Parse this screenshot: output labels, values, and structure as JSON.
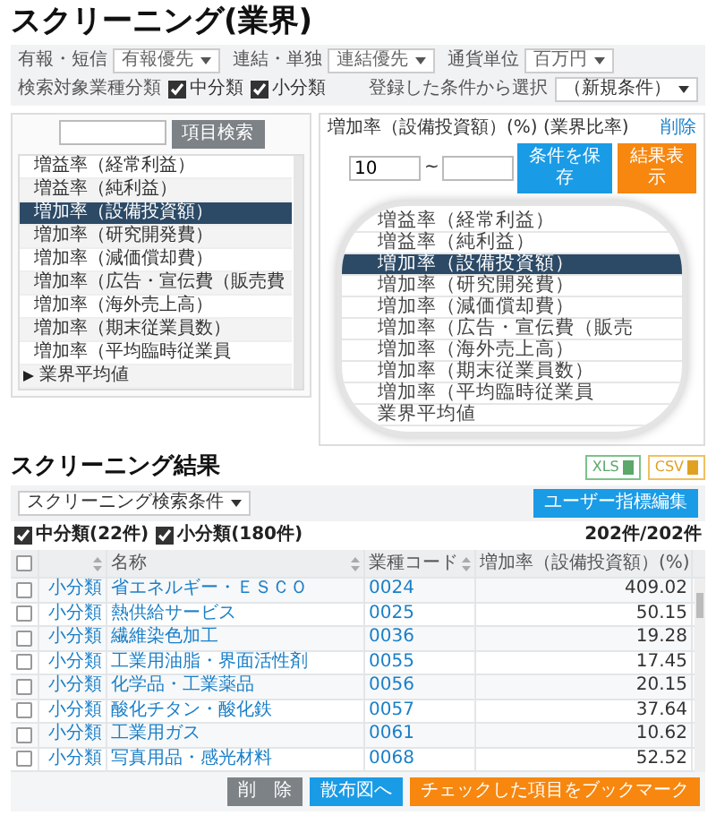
{
  "title": "スクリーニング(業界)",
  "options": [
    {
      "label": "有報・短信",
      "value": "有報優先"
    },
    {
      "label": "連結・単独",
      "value": "連結優先"
    },
    {
      "label": "通貨単位",
      "value": "百万円"
    }
  ],
  "target_filter": {
    "label": "検索対象業種分類",
    "options": [
      {
        "label": "中分類",
        "checked": true
      },
      {
        "label": "小分類",
        "checked": true
      }
    ]
  },
  "saved_conditions": {
    "label": "登録した条件から選択",
    "value": "（新規条件）"
  },
  "item_search": {
    "button": "項目検索"
  },
  "item_list": [
    {
      "kind": "item",
      "label": "増益率（経常利益）",
      "selected": false
    },
    {
      "kind": "item",
      "label": "増益率（純利益）",
      "selected": false
    },
    {
      "kind": "item",
      "label": "増加率（設備投資額）",
      "selected": true
    },
    {
      "kind": "item",
      "label": "増加率（研究開発費）",
      "selected": false
    },
    {
      "kind": "item",
      "label": "増加率（減価償却費）",
      "selected": false
    },
    {
      "kind": "item",
      "label": "増加率（広告・宣伝費（販売費",
      "selected": false
    },
    {
      "kind": "item",
      "label": "増加率（海外売上高）",
      "selected": false
    },
    {
      "kind": "item",
      "label": "増加率（期末従業員数）",
      "selected": false
    },
    {
      "kind": "item",
      "label": "増加率（平均臨時従業員",
      "selected": false
    },
    {
      "kind": "group",
      "label": "業界平均値",
      "selected": false,
      "expanded": false
    }
  ],
  "condition": {
    "label": "増加率（設備投資額）(%) (業界比率)",
    "delete": "削除",
    "min": "10",
    "separator": "~"
  },
  "magnifier": {
    "items": [
      {
        "label": "増益率（経常利益）",
        "selected": false
      },
      {
        "label": "増益率（純利益）",
        "selected": false
      },
      {
        "label": "増加率（設備投資額）",
        "selected": true
      },
      {
        "label": "増加率（研究開発費）",
        "selected": false
      },
      {
        "label": "増加率（減価償却費）",
        "selected": false
      },
      {
        "label": "増加率（広告・宣伝費（販売",
        "selected": false
      },
      {
        "label": "増加率（海外売上高）",
        "selected": false
      },
      {
        "label": "増加率（期末従業員数）",
        "selected": false
      },
      {
        "label": "増加率（平均臨時従業員",
        "selected": false
      },
      {
        "label": "業界平均値",
        "selected": false
      }
    ]
  },
  "condition_buttons": [
    {
      "label": "条件を保存",
      "kind": "primary"
    },
    {
      "label": "結果表示",
      "kind": "accent"
    }
  ],
  "results": {
    "title": "スクリーニング結果",
    "exports": [
      {
        "label": "XLS",
        "kind": "xls"
      },
      {
        "label": "CSV",
        "kind": "csv"
      }
    ],
    "preset": "スクリーニング検索条件",
    "user_button": "ユーザー指標編集",
    "filters": [
      {
        "label": "中分類(22件)",
        "checked": true
      },
      {
        "label": "小分類(180件)",
        "checked": true
      }
    ],
    "count": "202件/202件",
    "select_all": false,
    "columns": [
      "名称",
      "業種コード",
      "増加率（設備投資額）(%)"
    ],
    "rows": [
      {
        "checked": false,
        "class": "小分類",
        "name": "省エネルギー・ＥＳＣＯ",
        "code": "0024",
        "value": "409.02"
      },
      {
        "checked": false,
        "class": "小分類",
        "name": "熱供給サービス",
        "code": "0025",
        "value": "50.15"
      },
      {
        "checked": false,
        "class": "小分類",
        "name": "繊維染色加工",
        "code": "0036",
        "value": "19.28"
      },
      {
        "checked": false,
        "class": "小分類",
        "name": "工業用油脂・界面活性剤",
        "code": "0055",
        "value": "17.45"
      },
      {
        "checked": false,
        "class": "小分類",
        "name": "化学品・工業薬品",
        "code": "0056",
        "value": "20.15"
      },
      {
        "checked": false,
        "class": "小分類",
        "name": "酸化チタン・酸化鉄",
        "code": "0057",
        "value": "37.64"
      },
      {
        "checked": false,
        "class": "小分類",
        "name": "工業用ガス",
        "code": "0061",
        "value": "10.62"
      },
      {
        "checked": false,
        "class": "小分類",
        "name": "写真用品・感光材料",
        "code": "0068",
        "value": "52.52"
      }
    ],
    "actions": [
      {
        "label": "削　除",
        "kind": "neutral"
      },
      {
        "label": "散布図へ",
        "kind": "primary"
      },
      {
        "label": "チェックした項目をブックマーク",
        "kind": "accent"
      }
    ]
  }
}
